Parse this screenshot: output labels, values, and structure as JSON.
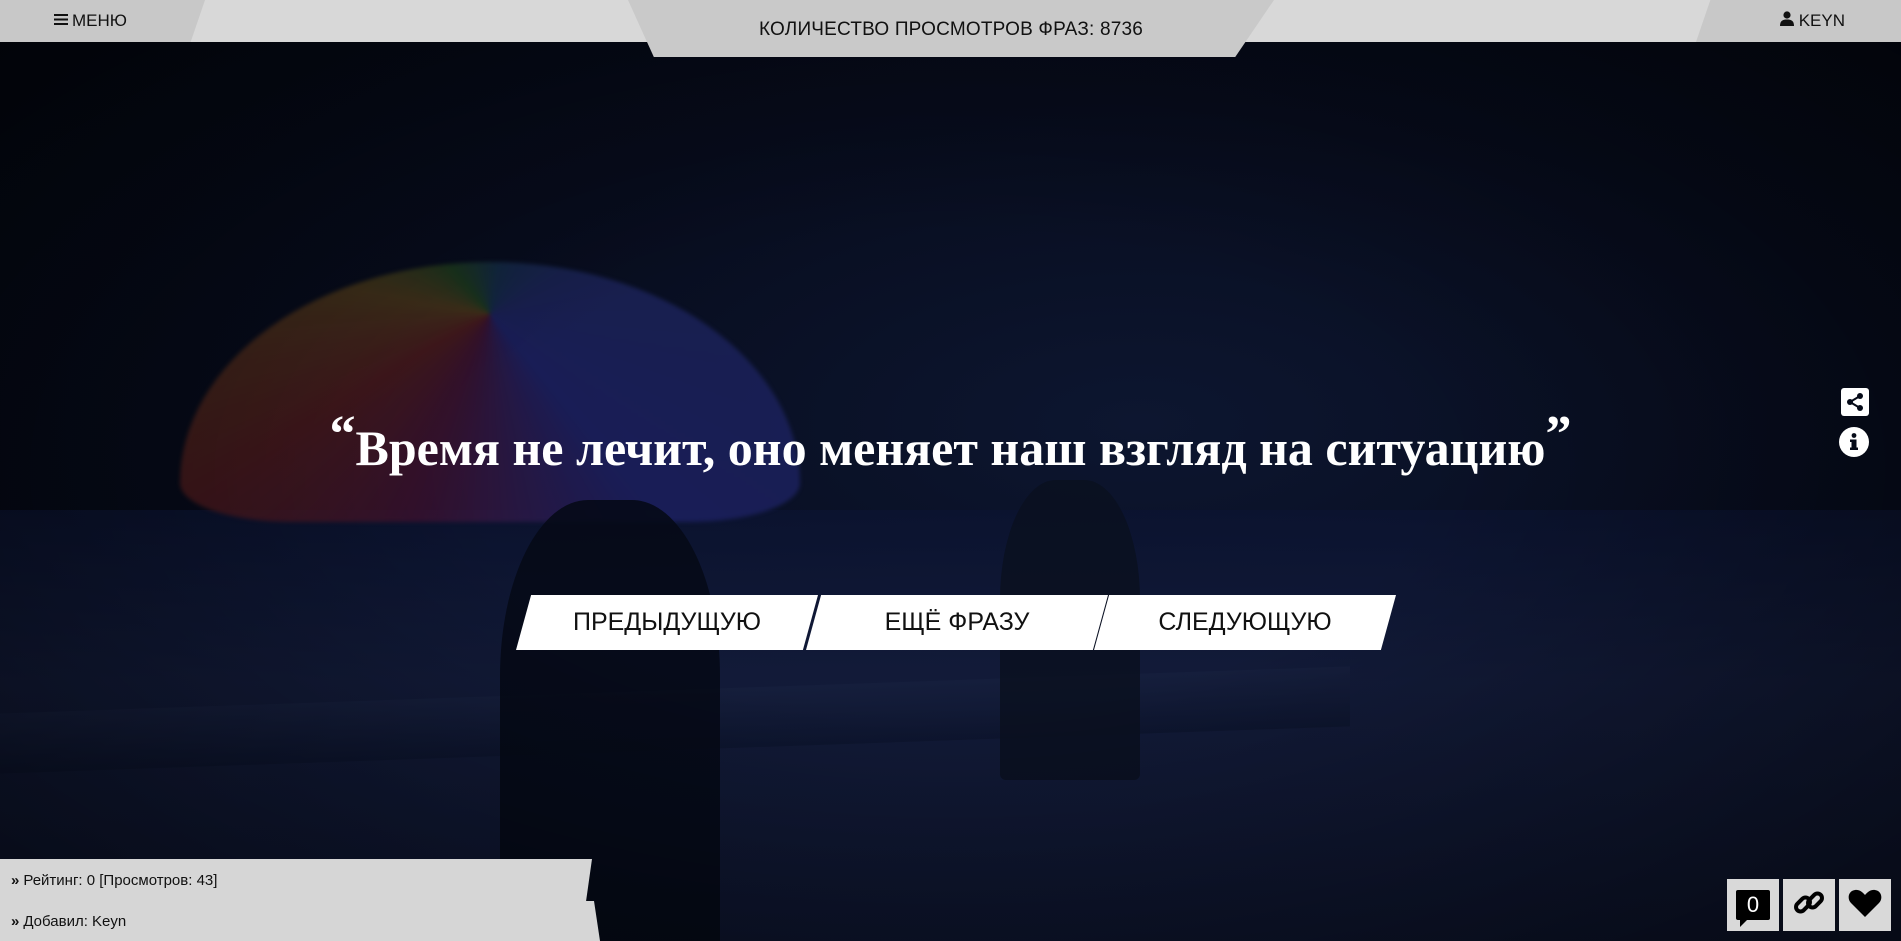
{
  "header": {
    "menu_label": "МЕНЮ",
    "menu_icon": "bars-icon",
    "counter_label": "КОЛИЧЕСТВО ПРОСМОТРОВ ФРАЗ: 8736",
    "user_label": "KEYN",
    "user_icon": "user-icon"
  },
  "quote": {
    "open_mark": "“",
    "text": "Время не лечит, оно меняет наш взгляд на ситуацию",
    "close_mark": "”"
  },
  "side_icons": [
    "share-icon",
    "info-icon"
  ],
  "navigation": {
    "prev_label": "ПРЕДЫДУЩУЮ",
    "more_label": "ЕЩЁ ФРАЗУ",
    "next_label": "СЛЕДУЮЩУЮ"
  },
  "meta": {
    "rating_text": "Рейтинг: 0 [Просмотров: 43]",
    "added_by_text": "Добавил: Keyn",
    "chevron_icon": "double-chevron-right-icon"
  },
  "actions": {
    "comment_count": "0",
    "icons": [
      "comment-icon",
      "link-icon",
      "heart-icon"
    ]
  },
  "colors": {
    "bar_bg": "#d8d8d8",
    "tab_bg": "#c8c8c8",
    "button_bg": "#ffffff",
    "page_bg": "#050a18"
  }
}
